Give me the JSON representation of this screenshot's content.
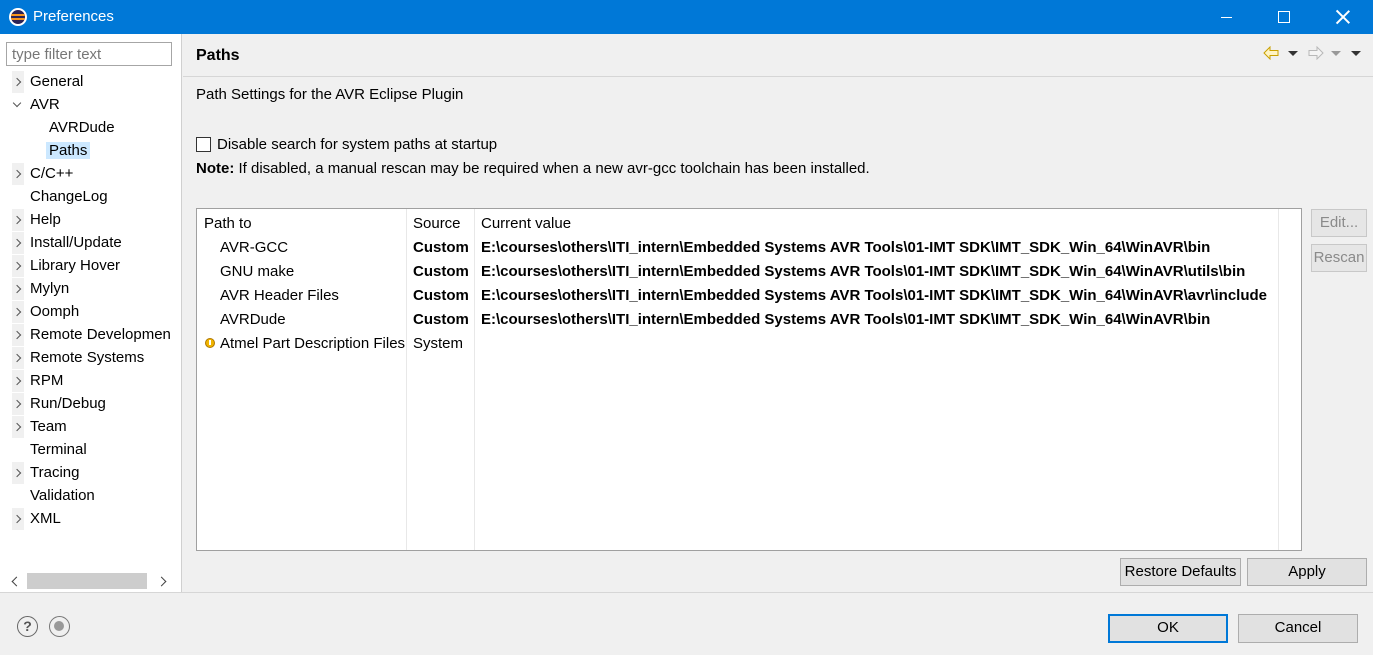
{
  "window": {
    "title": "Preferences"
  },
  "sidebar": {
    "filter_placeholder": "type filter text",
    "items": [
      {
        "label": "General",
        "expandable": true,
        "level": 0
      },
      {
        "label": "AVR",
        "expandable": true,
        "expanded": true,
        "level": 0
      },
      {
        "label": "AVRDude",
        "expandable": false,
        "level": 1
      },
      {
        "label": "Paths",
        "expandable": false,
        "level": 1,
        "selected": true
      },
      {
        "label": "C/C++",
        "expandable": true,
        "level": 0
      },
      {
        "label": "ChangeLog",
        "expandable": false,
        "level": 0
      },
      {
        "label": "Help",
        "expandable": true,
        "level": 0
      },
      {
        "label": "Install/Update",
        "expandable": true,
        "level": 0
      },
      {
        "label": "Library Hover",
        "expandable": true,
        "level": 0
      },
      {
        "label": "Mylyn",
        "expandable": true,
        "level": 0
      },
      {
        "label": "Oomph",
        "expandable": true,
        "level": 0
      },
      {
        "label": "Remote Developmen",
        "expandable": true,
        "level": 0
      },
      {
        "label": "Remote Systems",
        "expandable": true,
        "level": 0
      },
      {
        "label": "RPM",
        "expandable": true,
        "level": 0
      },
      {
        "label": "Run/Debug",
        "expandable": true,
        "level": 0
      },
      {
        "label": "Team",
        "expandable": true,
        "level": 0
      },
      {
        "label": "Terminal",
        "expandable": false,
        "level": 0
      },
      {
        "label": "Tracing",
        "expandable": true,
        "level": 0
      },
      {
        "label": "Validation",
        "expandable": false,
        "level": 0
      },
      {
        "label": "XML",
        "expandable": true,
        "level": 0
      }
    ]
  },
  "page": {
    "title": "Paths",
    "description": "Path Settings for the AVR Eclipse Plugin",
    "checkbox_label": "Disable search for system paths at startup",
    "checkbox_checked": false,
    "note_label": "Note:",
    "note_text": " If disabled, a manual rescan may be required when a new avr-gcc toolchain has been installed.",
    "table": {
      "columns": [
        "Path to",
        "Source",
        "Current value"
      ],
      "rows": [
        {
          "path": "AVR-GCC",
          "source": "Custom",
          "value": "E:\\courses\\others\\ITI_intern\\Embedded Systems AVR Tools\\01-IMT SDK\\IMT_SDK_Win_64\\WinAVR\\bin",
          "warning": false
        },
        {
          "path": "GNU make",
          "source": "Custom",
          "value": "E:\\courses\\others\\ITI_intern\\Embedded Systems AVR Tools\\01-IMT SDK\\IMT_SDK_Win_64\\WinAVR\\utils\\bin",
          "warning": false
        },
        {
          "path": "AVR Header Files",
          "source": "Custom",
          "value": "E:\\courses\\others\\ITI_intern\\Embedded Systems AVR Tools\\01-IMT SDK\\IMT_SDK_Win_64\\WinAVR\\avr\\include",
          "warning": false
        },
        {
          "path": "AVRDude",
          "source": "Custom",
          "value": "E:\\courses\\others\\ITI_intern\\Embedded Systems AVR Tools\\01-IMT SDK\\IMT_SDK_Win_64\\WinAVR\\bin",
          "warning": false
        },
        {
          "path": "Atmel Part Description Files",
          "source": "System",
          "value": "",
          "warning": true
        }
      ]
    },
    "edit_label": "Edit...",
    "rescan_label": "Rescan",
    "restore_defaults_label": "Restore Defaults",
    "apply_label": "Apply"
  },
  "footer": {
    "ok_label": "OK",
    "cancel_label": "Cancel"
  },
  "icons": {
    "help": "help-icon",
    "preferences": "oomph-preferences-icon",
    "back": "back-arrow-icon",
    "forward": "forward-arrow-icon",
    "warning": "warning-icon"
  },
  "colors": {
    "titlebar": "#0078d7",
    "selection": "#cce8ff",
    "warning": "#f0b400"
  }
}
